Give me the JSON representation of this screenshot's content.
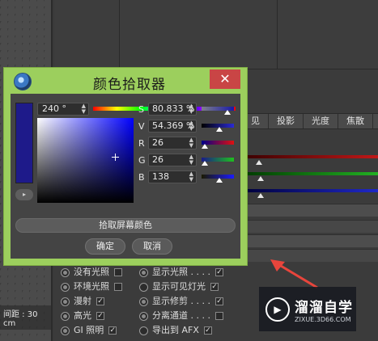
{
  "viewport": {
    "label": "间距 : 30 cm"
  },
  "tabs": [
    "见",
    "投影",
    "光度",
    "焦散"
  ],
  "options_left": [
    {
      "label": "没有光照",
      "checked": false
    },
    {
      "label": "环境光照",
      "checked": false
    },
    {
      "label": "漫射",
      "checked": true
    },
    {
      "label": "高光",
      "checked": true
    },
    {
      "label": "GI 照明",
      "checked": true
    }
  ],
  "options_right": [
    {
      "label": "显示光照 . . . .",
      "checked": true
    },
    {
      "label": "显示可见灯光",
      "checked": true
    },
    {
      "label": "显示修剪 . . . .",
      "checked": true
    },
    {
      "label": "分离通道 . . . .",
      "checked": false
    },
    {
      "label": "导出到 AFX",
      "checked": true
    }
  ],
  "dialog": {
    "title": "颜色拾取器",
    "close_label": "✕",
    "hue_value": "240 °",
    "hue": 240,
    "saturation_fraction": 0.808,
    "brightness_fraction": 0.544,
    "channels": [
      {
        "label": "S",
        "value": "80.833 %",
        "level": 0.808,
        "gradient": "sat"
      },
      {
        "label": "V",
        "value": "54.369 %",
        "level": 0.544,
        "gradient": "val"
      },
      {
        "label": "R",
        "value": "26",
        "level": 0.1,
        "gradient": "red"
      },
      {
        "label": "G",
        "value": "26",
        "level": 0.1,
        "gradient": "green"
      },
      {
        "label": "B",
        "value": "138",
        "level": 0.54,
        "gradient": "blue"
      }
    ],
    "pick_screen_label": "拾取屏幕颜色",
    "ok_label": "确定",
    "cancel_label": "取消",
    "current_color": "#1e1a8a"
  },
  "watermark": {
    "title": "溜溜自学",
    "subtitle": "ZIXUE.3D66.COM"
  },
  "colors": {
    "dialog_frame": "#9ccf5d",
    "close_button": "#c94545",
    "arrow": "#e8453c"
  }
}
